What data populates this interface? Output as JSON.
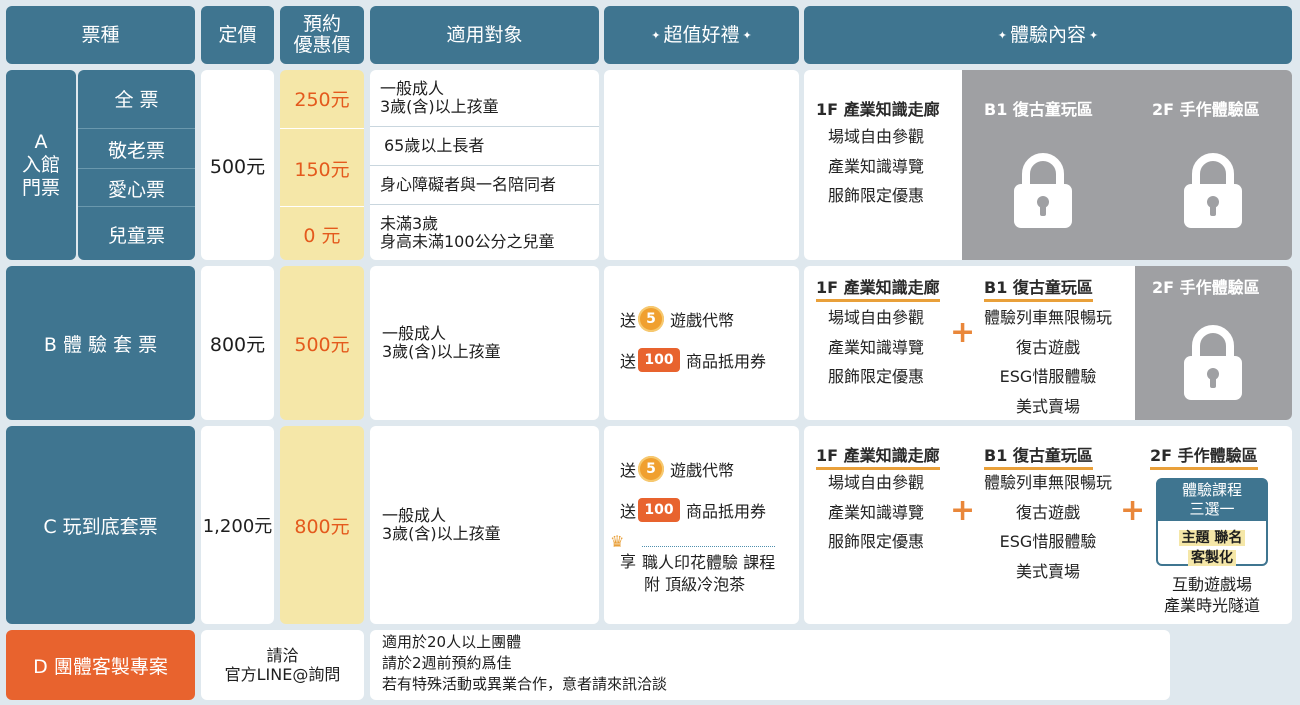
{
  "header": {
    "ticket_type": "票種",
    "list_price": "定價",
    "preorder_line1": "預約",
    "preorder_line2": "優惠價",
    "audience": "適用對象",
    "gift": "超值好禮",
    "content": "體驗內容"
  },
  "row_a": {
    "code": "A",
    "name_line1": "入館",
    "name_line2": "門票",
    "subtypes": [
      "全 票",
      "敬老票",
      "愛心票",
      "兒童票"
    ],
    "price": "500元",
    "discounts": [
      "250元",
      "150元",
      "0 元"
    ],
    "targets": [
      [
        "一般成人",
        "3歲(含)以上孩童"
      ],
      [
        "65歲以上長者"
      ],
      [
        "身心障礙者與一名陪同者"
      ],
      [
        "未滿3歲",
        "身高未滿100公分之兒童"
      ]
    ],
    "zone_1f_title": "1F 產業知識走廊",
    "zone_1f_items": [
      "場域自由參觀",
      "產業知識導覽",
      "服飾限定優惠"
    ],
    "zone_b1_title": "B1 復古童玩區",
    "zone_2f_title": "2F 手作體驗區"
  },
  "row_b": {
    "name": "B 體 驗 套 票",
    "price": "800元",
    "discount": "500元",
    "target_line1": "一般成人",
    "target_line2": "3歲(含)以上孩童",
    "gift_send1": "送",
    "coin_num": "5",
    "gift_item1": "遊戲代幣",
    "gift_send2": "送",
    "ticket_num": "100",
    "gift_item2": "商品抵用券",
    "zone_1f_title": "1F 產業知識走廊",
    "zone_1f_items": [
      "場域自由參觀",
      "產業知識導覽",
      "服飾限定優惠"
    ],
    "zone_b1_title": "B1 復古童玩區",
    "zone_b1_items": [
      "體驗列車無限暢玩",
      "復古遊戲",
      "ESG惜服體驗",
      "美式賣場"
    ],
    "zone_2f_title": "2F 手作體驗區"
  },
  "row_c": {
    "name": "C 玩到底套票",
    "price": "1,200元",
    "discount": "800元",
    "target_line1": "一般成人",
    "target_line2": "3歲(含)以上孩童",
    "gift_send1": "送",
    "coin_num": "5",
    "gift_item1": "遊戲代幣",
    "gift_send2": "送",
    "ticket_num": "100",
    "gift_item2": "商品抵用券",
    "gift_enjoy": "享",
    "gift_course": "職人印花體驗 課程",
    "gift_tea": "附 頂級冷泡茶",
    "zone_1f_title": "1F 產業知識走廊",
    "zone_1f_items": [
      "場域自由參觀",
      "產業知識導覽",
      "服飾限定優惠"
    ],
    "zone_b1_title": "B1 復古童玩區",
    "zone_b1_items": [
      "體驗列車無限暢玩",
      "復古遊戲",
      "ESG惜服體驗",
      "美式賣場"
    ],
    "zone_2f_title": "2F 手作體驗區",
    "course_line1": "體驗課程",
    "course_line2": "三選一",
    "tag1": "主題 聯名",
    "tag2": "客製化",
    "extra1": "互動遊戲場",
    "extra2": "產業時光隧道"
  },
  "row_d": {
    "name": "D 團體客製專案",
    "contact_line1": "請洽",
    "contact_line2": "官方LINE@詢問",
    "notes": [
      "適用於20人以上團體",
      "請於2週前預約爲佳",
      "若有特殊活動或異業合作，意者請來訊洽談"
    ]
  },
  "colors": {
    "teal": "#3f7590",
    "discount_bg": "#f5e7a8",
    "discount_text": "#e45a1d",
    "locked_bg": "#9fa0a3",
    "group_bg": "#e8632e",
    "accent": "#e9873a"
  }
}
